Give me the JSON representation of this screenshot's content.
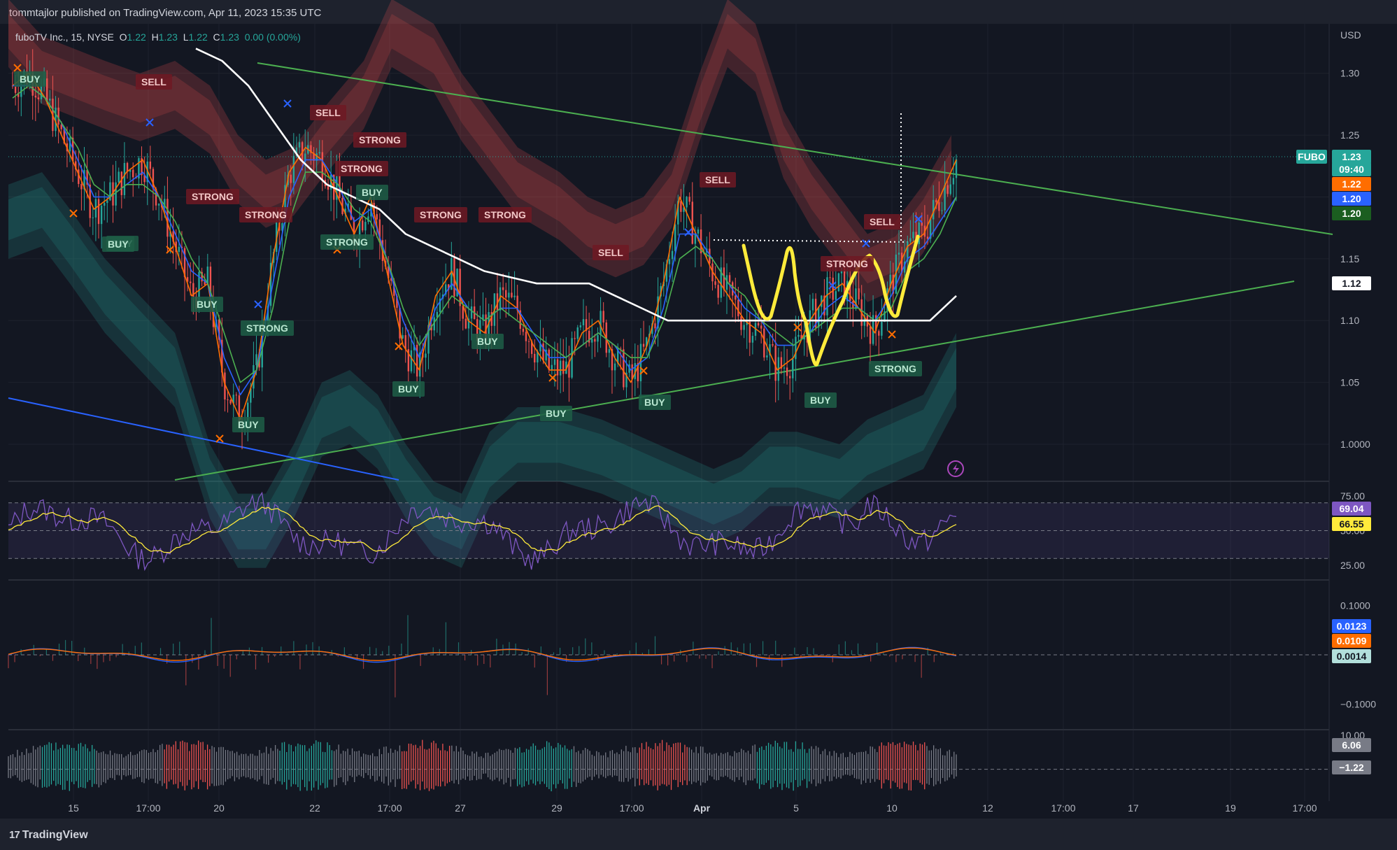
{
  "header": {
    "published": "tommtajlor published on TradingView.com, Apr 11, 2023 15:35 UTC"
  },
  "legend": {
    "symbol": "fuboTV Inc., 15, NYSE",
    "o_label": "O",
    "o": "1.22",
    "h_label": "H",
    "h": "1.23",
    "l_label": "L",
    "l": "1.22",
    "c_label": "C",
    "c": "1.23",
    "chg": "0.00 (0.00%)"
  },
  "footer": {
    "brand": "TradingView",
    "logo_glyph": "17"
  },
  "colors": {
    "up": "#26a69a",
    "down": "#ef5350",
    "accent_blue": "#2962ff",
    "orange": "#ff6d00",
    "yellow": "#ffeb3b",
    "purple": "#7e57c2"
  },
  "chart_data": [
    {
      "type": "line",
      "panel": "price",
      "currency": "USD",
      "y_ticks": [
        "1.30",
        "1.25",
        "1.20",
        "1.15",
        "1.10",
        "1.05",
        "1.0000"
      ],
      "ylim": [
        0.97,
        1.34
      ],
      "x_ticks": [
        "15",
        "17:00",
        "20",
        "22",
        "17:00",
        "27",
        "29",
        "17:00",
        "Apr",
        "5",
        "10",
        "12",
        "17:00",
        "17",
        "19",
        "17:00"
      ],
      "price_labels": [
        {
          "text": "FUBO",
          "color": "#26a69a"
        },
        {
          "text": "1.23",
          "color": "#26a69a"
        },
        {
          "text": "09:40",
          "color": "#26a69a"
        },
        {
          "text": "1.22",
          "color": "#ff6d00"
        },
        {
          "text": "1.20",
          "color": "#2962ff"
        },
        {
          "text": "1.20",
          "color": "#1b5e20"
        },
        {
          "text": "1.12",
          "color": "#ffffff"
        }
      ],
      "series": [
        {
          "values": [
            1.29,
            1.3,
            1.28,
            1.25,
            1.22,
            1.19,
            1.2,
            1.22,
            1.23,
            1.2,
            1.16,
            1.12,
            1.13,
            1.05,
            1.02,
            1.06,
            1.15,
            1.22,
            1.24,
            1.23,
            1.2,
            1.17,
            1.2,
            1.14,
            1.08,
            1.06,
            1.12,
            1.14,
            1.1,
            1.09,
            1.12,
            1.11,
            1.08,
            1.06,
            1.06,
            1.09,
            1.1,
            1.07,
            1.05,
            1.08,
            1.13,
            1.2,
            1.17,
            1.14,
            1.12,
            1.1,
            1.09,
            1.06,
            1.07,
            1.1,
            1.12,
            1.13,
            1.11,
            1.09,
            1.13,
            1.16,
            1.17,
            1.2,
            1.23
          ]
        },
        {
          "values": [
            1.29,
            1.29,
            1.28,
            1.26,
            1.23,
            1.2,
            1.2,
            1.21,
            1.22,
            1.2,
            1.17,
            1.14,
            1.13,
            1.07,
            1.04,
            1.06,
            1.13,
            1.2,
            1.23,
            1.23,
            1.21,
            1.18,
            1.19,
            1.15,
            1.1,
            1.07,
            1.11,
            1.13,
            1.11,
            1.1,
            1.11,
            1.11,
            1.09,
            1.07,
            1.07,
            1.08,
            1.09,
            1.08,
            1.06,
            1.07,
            1.11,
            1.17,
            1.17,
            1.15,
            1.13,
            1.11,
            1.1,
            1.08,
            1.08,
            1.09,
            1.11,
            1.12,
            1.11,
            1.1,
            1.12,
            1.15,
            1.16,
            1.18,
            1.2
          ]
        },
        {
          "values": [
            1.28,
            1.29,
            1.28,
            1.26,
            1.24,
            1.21,
            1.2,
            1.21,
            1.21,
            1.2,
            1.18,
            1.15,
            1.13,
            1.09,
            1.05,
            1.06,
            1.11,
            1.18,
            1.22,
            1.22,
            1.21,
            1.19,
            1.18,
            1.15,
            1.11,
            1.08,
            1.1,
            1.12,
            1.11,
            1.1,
            1.11,
            1.1,
            1.09,
            1.08,
            1.07,
            1.08,
            1.09,
            1.08,
            1.07,
            1.07,
            1.1,
            1.15,
            1.16,
            1.15,
            1.13,
            1.12,
            1.1,
            1.09,
            1.08,
            1.09,
            1.1,
            1.11,
            1.11,
            1.1,
            1.11,
            1.14,
            1.15,
            1.17,
            1.2
          ]
        },
        {
          "values": [
            1.32,
            1.31,
            1.29,
            1.26,
            1.23,
            1.21,
            1.2,
            1.19,
            1.17,
            1.16,
            1.15,
            1.14,
            1.135,
            1.13,
            1.13,
            1.13,
            1.12,
            1.11,
            1.1,
            1.1,
            1.1,
            1.1,
            1.1,
            1.1,
            1.1,
            1.1,
            1.1,
            1.1,
            1.1,
            1.12
          ]
        }
      ],
      "signals": [
        {
          "text": "BUY",
          "kind": "buy"
        },
        {
          "text": "SELL",
          "kind": "sell"
        },
        {
          "text": "BUY",
          "kind": "buy"
        },
        {
          "text": "STRONG",
          "kind": "sell"
        },
        {
          "text": "STRONG",
          "kind": "sell"
        },
        {
          "text": "BUY",
          "kind": "buy"
        },
        {
          "text": "STRONG",
          "kind": "buy"
        },
        {
          "text": "BUY",
          "kind": "buy"
        },
        {
          "text": "SELL",
          "kind": "sell"
        },
        {
          "text": "STRONG",
          "kind": "sell"
        },
        {
          "text": "STRONG",
          "kind": "sell"
        },
        {
          "text": "STRONG",
          "kind": "buy"
        },
        {
          "text": "BUY",
          "kind": "buy"
        },
        {
          "text": "STRONG",
          "kind": "sell"
        },
        {
          "text": "STRONG",
          "kind": "sell"
        },
        {
          "text": "BUY",
          "kind": "buy"
        },
        {
          "text": "BUY",
          "kind": "buy"
        },
        {
          "text": "SELL",
          "kind": "sell"
        },
        {
          "text": "BUY",
          "kind": "buy"
        },
        {
          "text": "BUY",
          "kind": "buy"
        },
        {
          "text": "SELL",
          "kind": "sell"
        },
        {
          "text": "STRONG",
          "kind": "sell"
        },
        {
          "text": "SELL",
          "kind": "sell"
        },
        {
          "text": "BUY",
          "kind": "buy"
        },
        {
          "text": "BUY",
          "kind": "buy"
        },
        {
          "text": "STRONG",
          "kind": "buy"
        }
      ]
    },
    {
      "type": "line",
      "panel": "rsi",
      "y_ticks": [
        "75.00",
        "50.00",
        "25.00"
      ],
      "ylim": [
        15,
        85
      ],
      "value_labels": [
        {
          "text": "69.04",
          "color": "#7e57c2"
        },
        {
          "text": "66.55",
          "color": "#ffeb3b"
        }
      ]
    },
    {
      "type": "line",
      "panel": "macd",
      "y_ticks": [
        "0.1000",
        "−0.1000"
      ],
      "ylim": [
        -0.15,
        0.15
      ],
      "value_labels": [
        {
          "text": "0.0123",
          "color": "#2962ff"
        },
        {
          "text": "0.0109",
          "color": "#ff6d00"
        },
        {
          "text": "0.0014",
          "color": "#b2dfdb"
        }
      ]
    },
    {
      "type": "bar",
      "panel": "oscillator",
      "y_ticks": [
        "10.00"
      ],
      "ylim": [
        -12,
        12
      ],
      "value_labels": [
        {
          "text": "6.06",
          "color": "#787b86"
        },
        {
          "text": "−1.22",
          "color": "#787b86"
        }
      ]
    }
  ]
}
